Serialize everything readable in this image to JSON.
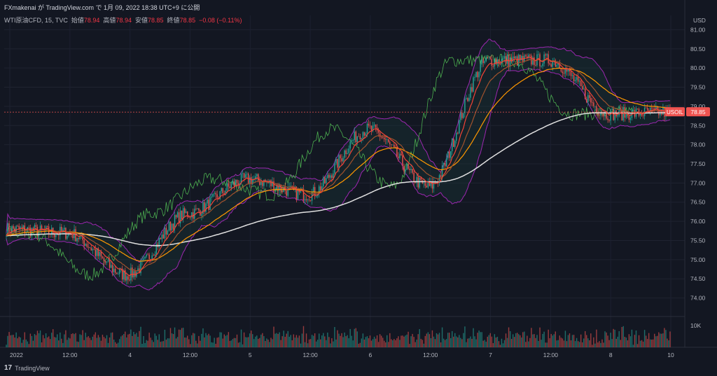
{
  "header": {
    "share_line": "FXmakenai が TradingView.com で 1月 09, 2022 18:38 UTC+9 に公開",
    "symbol": "WTI原油CFD, 15, TVC",
    "open_label": "始値",
    "open": "78.94",
    "high_label": "高値",
    "high": "78.94",
    "low_label": "安値",
    "low": "78.85",
    "close_label": "終値",
    "close": "78.85",
    "change": "−0.08 (−0.11%)"
  },
  "watermark": {
    "brand": "TradingView",
    "glyph": "17"
  },
  "price_axis": {
    "currency": "USD",
    "ticks": [
      "81.00",
      "80.50",
      "80.00",
      "79.50",
      "79.00",
      "78.50",
      "78.00",
      "77.50",
      "77.00",
      "76.50",
      "76.00",
      "75.50",
      "75.00",
      "74.50",
      "74.00"
    ],
    "volume_tick": "10K",
    "last_label": "USOIL",
    "last_price": "78.85"
  },
  "time_axis": [
    "2022",
    "12:00",
    "4",
    "12:00",
    "5",
    "12:00",
    "6",
    "12:00",
    "7",
    "12:00",
    "8",
    "10"
  ],
  "colors": {
    "background": "#131722",
    "up": "#26a69a",
    "down": "#ef5350",
    "bb": "#9c27b0",
    "ema_fast": "#f44336",
    "ema_mid": "#ff9800",
    "sma200": "#e0e0e0",
    "lag": "#4caf50"
  },
  "chart_data": {
    "type": "line",
    "ylim": [
      73.7,
      81.3
    ],
    "series": [
      {
        "name": "",
        "x": [
          "2022",
          "12:00",
          "4",
          "12:00",
          "5",
          "12:00",
          "6",
          "12:00",
          "7",
          "12:00",
          "8",
          "10"
        ],
        "values": [
          75.8,
          75.7,
          74.6,
          76.2,
          77.1,
          76.7,
          78.4,
          76.9,
          80.2,
          80.2,
          78.8,
          78.85
        ]
      }
    ]
  }
}
